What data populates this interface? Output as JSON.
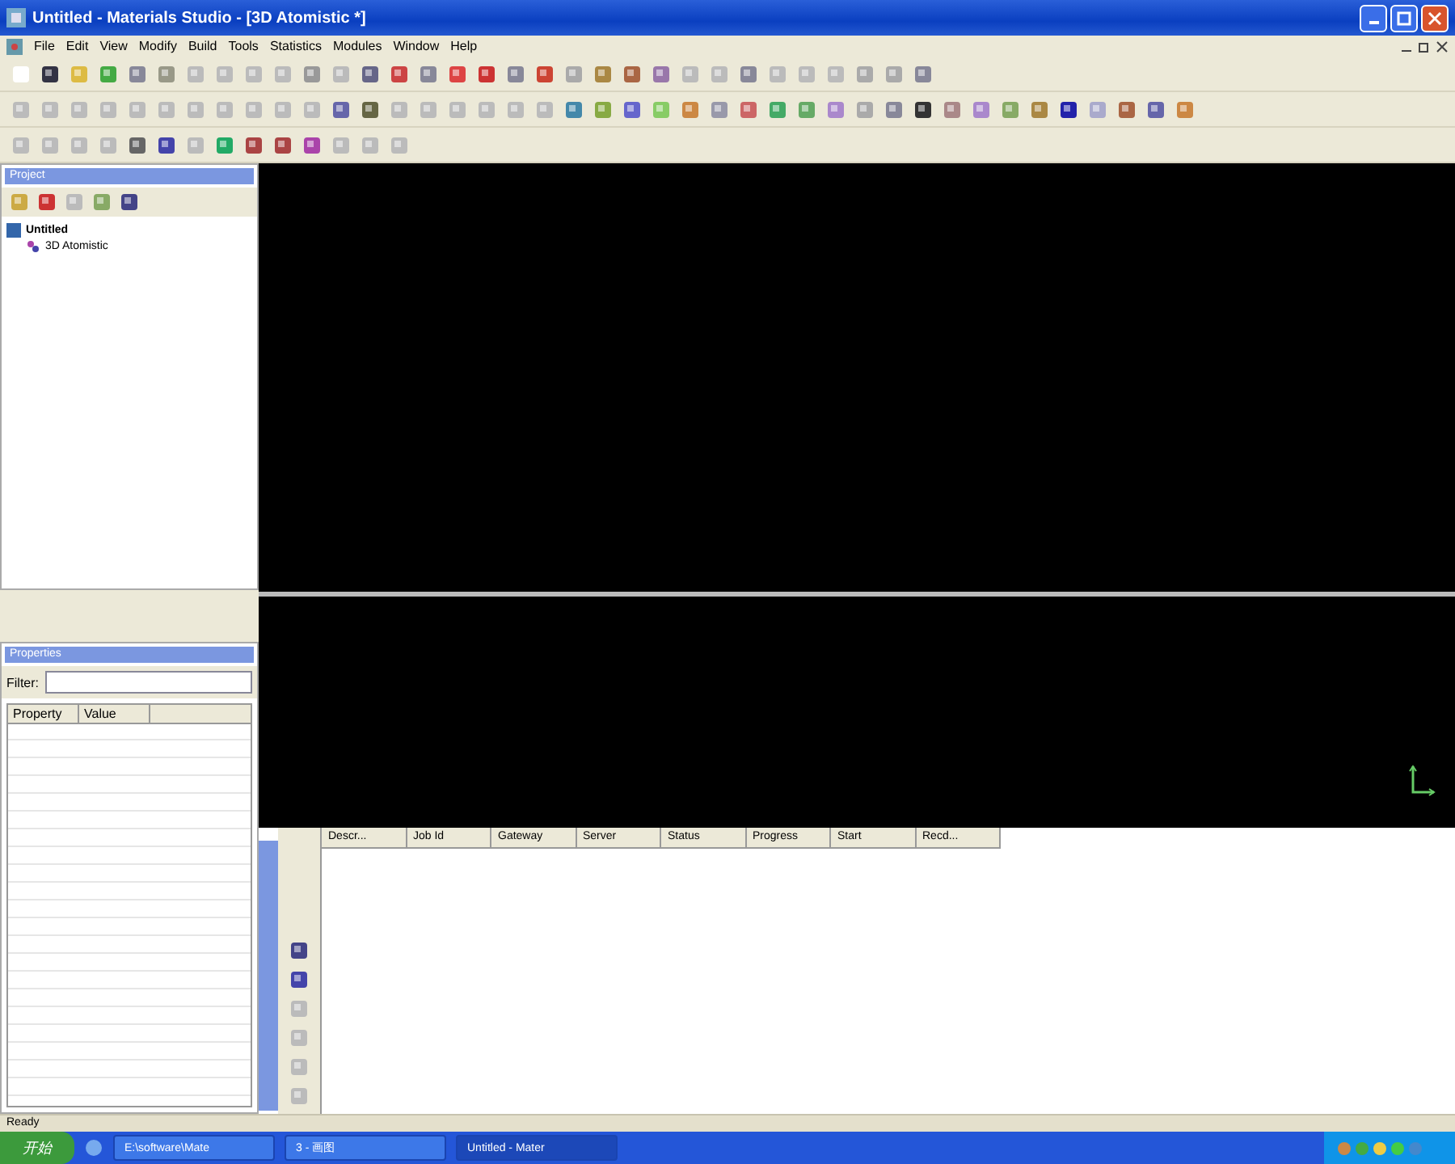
{
  "window": {
    "title": "Untitled - Materials Studio - [3D Atomistic *]"
  },
  "menu": [
    "File",
    "Edit",
    "View",
    "Modify",
    "Build",
    "Tools",
    "Statistics",
    "Modules",
    "Window",
    "Help"
  ],
  "project": {
    "title": "Project",
    "tree": [
      {
        "label": "Untitled",
        "expanded": true,
        "children": [
          {
            "label": "3D Atomistic"
          }
        ]
      }
    ]
  },
  "properties": {
    "title": "Properties",
    "filter_label": "Filter:",
    "columns": [
      "Property",
      "Value"
    ]
  },
  "jobs": {
    "columns": [
      "Descr...",
      "Job Id",
      "Gateway",
      "Server",
      "Status",
      "Progress",
      "Start",
      "Recd..."
    ]
  },
  "status_bar": "Ready",
  "taskbar": {
    "start": "开始",
    "tasks": [
      {
        "label": "E:\\software\\Mate",
        "selected": false
      },
      {
        "label": "3 - 画图",
        "selected": false
      },
      {
        "label": "Untitled - Mater",
        "selected": true
      }
    ]
  }
}
